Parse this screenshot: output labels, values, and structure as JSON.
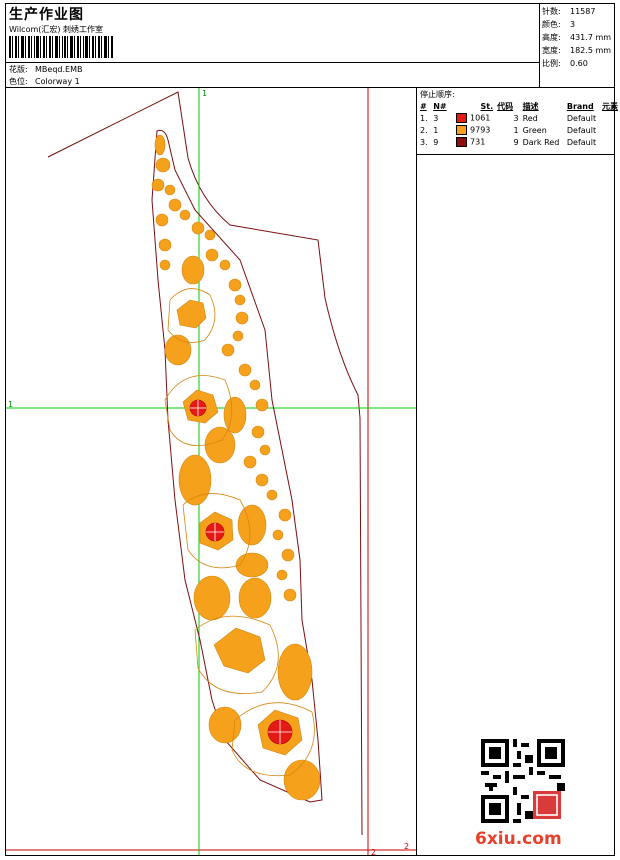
{
  "header": {
    "title": "生产作业图",
    "company": "Wilcom(汇宏) 刺绣工作室",
    "design_label": "花版:",
    "design_value": "MBeqd.EMB",
    "colorway_label": "色位:",
    "colorway_value": "Colorway 1"
  },
  "stats": {
    "stitches_label": "针数:",
    "stitches_value": "11587",
    "colors_label": "颜色:",
    "colors_value": "3",
    "height_label": "高度:",
    "height_value": "431.7 mm",
    "width_label": "宽度:",
    "width_value": "182.5 mm",
    "scale_label": "比例:",
    "scale_value": "0.60"
  },
  "stop_sequence": {
    "title": "停止顺序:",
    "headers": {
      "no": "#",
      "needle": "N#",
      "stitches": "St.",
      "code": "代码",
      "desc": "描述",
      "brand": "Brand",
      "elements": "元素"
    },
    "rows": [
      {
        "no": "1.",
        "needle": "3",
        "color": "#e31b14",
        "stitches": "1061",
        "code": "3",
        "desc": "Red",
        "brand": "Default"
      },
      {
        "no": "2.",
        "needle": "1",
        "color": "#f5a11c",
        "stitches": "9793",
        "code": "1",
        "desc": "Green",
        "brand": "Default"
      },
      {
        "no": "3.",
        "needle": "9",
        "color": "#8c1010",
        "stitches": "731",
        "code": "9",
        "desc": "Dark Red",
        "brand": "Default"
      }
    ]
  },
  "canvas": {
    "marker_top": "1",
    "marker_left": "1",
    "marker_bottom": "2",
    "marker_right": "2",
    "outline_color": "#7a0e10",
    "guide_color": "#00cc00",
    "limit_color": "#cc0000",
    "fill_main": "#f5a11c",
    "fill_accent": "#e31b14"
  },
  "watermark": {
    "brand": "6xiu.com",
    "seal": "印章"
  }
}
